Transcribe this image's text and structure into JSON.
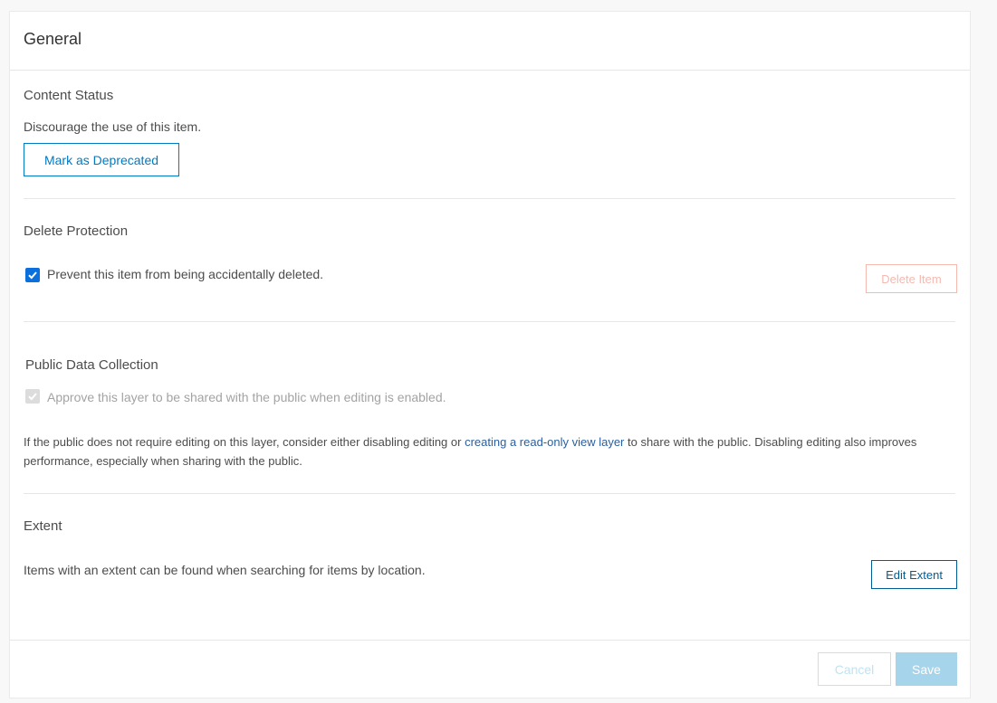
{
  "panel": {
    "title": "General"
  },
  "content_status": {
    "heading": "Content Status",
    "description": "Discourage the use of this item.",
    "deprecate_button": "Mark as Deprecated"
  },
  "delete_protection": {
    "heading": "Delete Protection",
    "checkbox_label": "Prevent this item from being accidentally deleted.",
    "checked": true,
    "delete_button": "Delete Item"
  },
  "public_data": {
    "heading": "Public Data Collection",
    "checkbox_label": "Approve this layer to be shared with the public when editing is enabled.",
    "checked": true,
    "disabled": true,
    "info_before": "If the public does not require editing on this layer, consider either disabling editing or ",
    "info_link": "creating a read-only view layer",
    "info_after": " to share with the public. Disabling editing also improves performance, especially when sharing with the public."
  },
  "extent": {
    "heading": "Extent",
    "description": "Items with an extent can be found when searching for items by location.",
    "edit_button": "Edit Extent"
  },
  "footer": {
    "cancel_label": "Cancel",
    "save_label": "Save"
  },
  "colors": {
    "accent": "#007ac2",
    "checkbox": "#0b6fdc",
    "danger_disabled": "#f5b9b0",
    "link": "#2a5f9e"
  }
}
